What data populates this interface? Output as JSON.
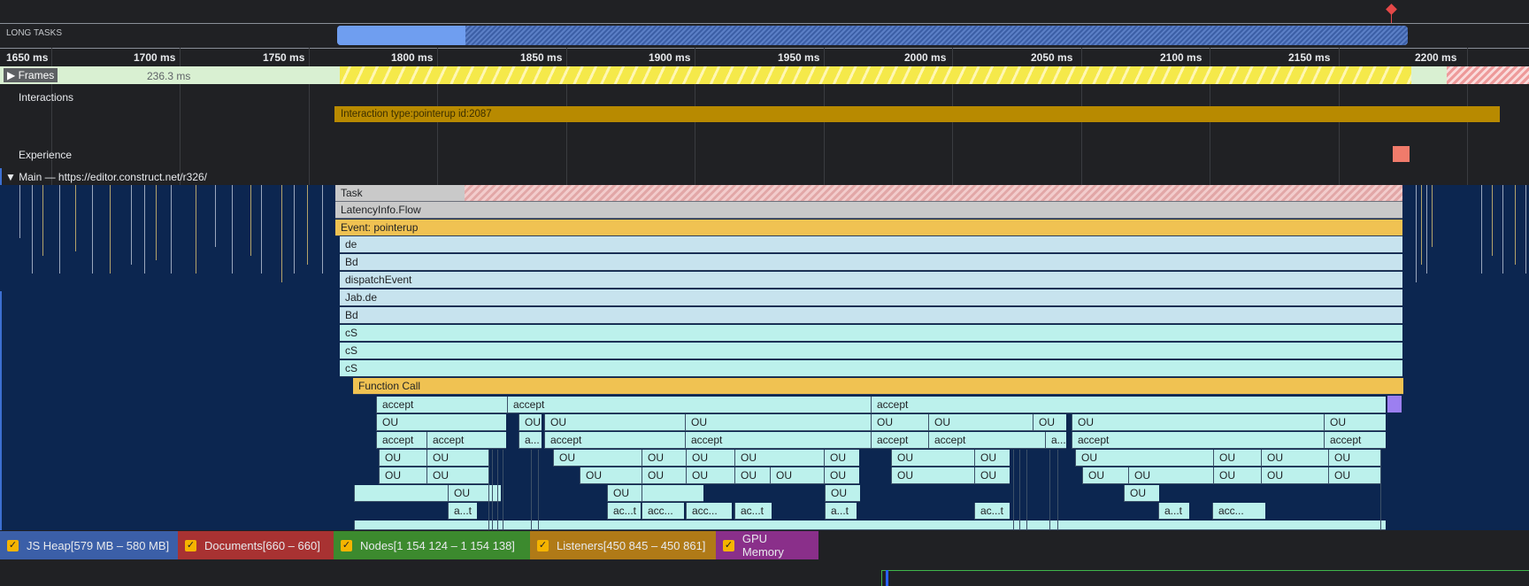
{
  "long_tasks": {
    "label": "LONG TASKS"
  },
  "ruler": {
    "ticks": [
      "1650 ms",
      "1700 ms",
      "1750 ms",
      "1800 ms",
      "1850 ms",
      "1900 ms",
      "1950 ms",
      "2000 ms",
      "2050 ms",
      "2100 ms",
      "2150 ms",
      "2200 ms"
    ]
  },
  "frames": {
    "label": "Frames",
    "duration": "236.3 ms"
  },
  "interactions": {
    "label": "Interactions",
    "bar_text": "Interaction type:pointerup id:2087"
  },
  "experience": {
    "label": "Experience"
  },
  "main": {
    "label": "Main — https://editor.construct.net/r326/"
  },
  "flame": {
    "task": "Task",
    "latency": "LatencyInfo.Flow",
    "event": "Event: pointerup",
    "stack": [
      "de",
      "Bd",
      "dispatchEvent",
      "Jab.de",
      "Bd",
      "cS",
      "cS",
      "cS"
    ],
    "function_call": "Function Call",
    "accept": "accept",
    "ou": "OU",
    "a_ellipsis": "a...",
    "at_ellipsis": "a...t",
    "ac_ellipsis": "ac...t",
    "acc_ellipsis": "acc..."
  },
  "legend": {
    "js_heap": "JS Heap[579 MB – 580 MB]",
    "documents": "Documents[660 – 660]",
    "nodes": "Nodes[1 154 124 – 1 154 138]",
    "listeners": "Listeners[450 845 – 450 861]",
    "gpu_memory": "GPU Memory",
    "colors": {
      "js_heap": "#3b5fa8",
      "documents": "#a83232",
      "nodes": "#3c8a2e",
      "listeners": "#b07a17",
      "gpu_memory": "#8a2f8a"
    }
  }
}
